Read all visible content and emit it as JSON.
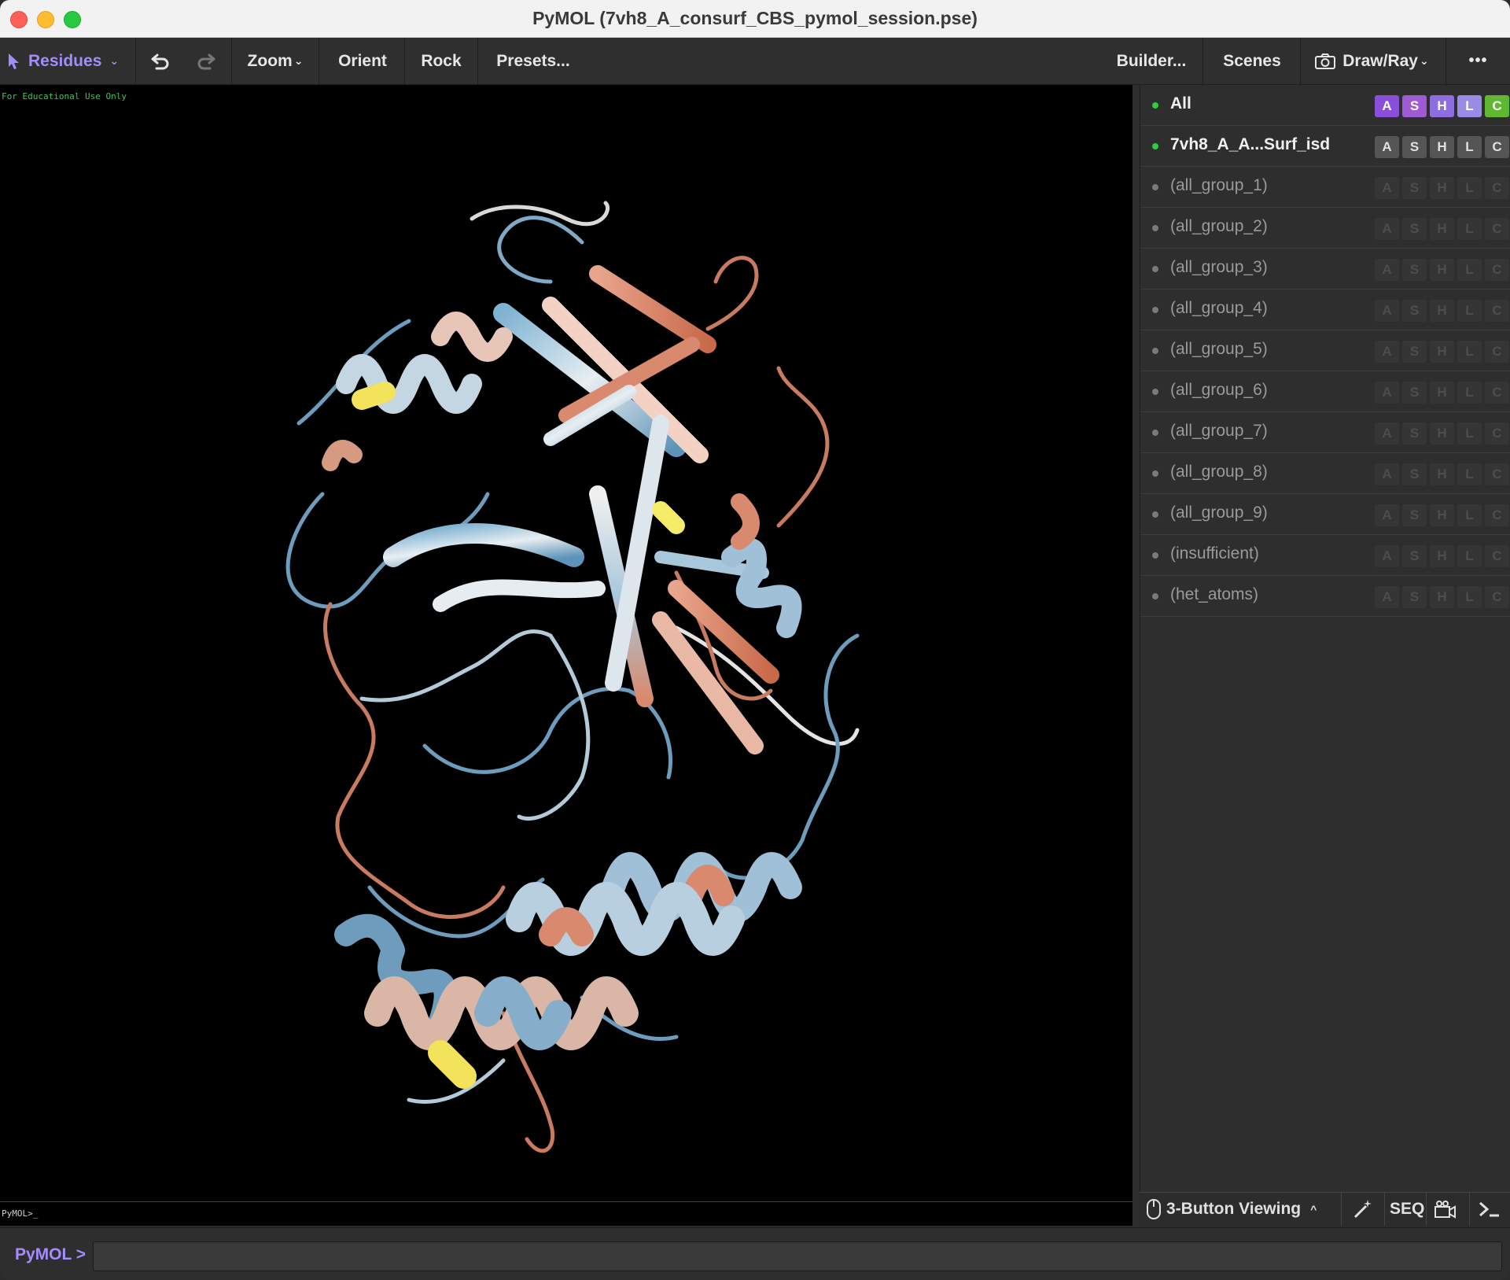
{
  "window": {
    "title": "PyMOL (7vh8_A_consurf_CBS_pymol_session.pse)"
  },
  "toolbar": {
    "residues_label": "Residues",
    "zoom_label": "Zoom",
    "orient_label": "Orient",
    "rock_label": "Rock",
    "presets_label": "Presets...",
    "builder_label": "Builder...",
    "scenes_label": "Scenes",
    "drawray_label": "Draw/Ray",
    "more_label": "•••"
  },
  "viewport": {
    "watermark": "For Educational Use Only",
    "prompt_text": "PyMOL>_"
  },
  "objects": [
    {
      "label": "All",
      "enabled": true,
      "bold": true
    },
    {
      "label": "7vh8_A_A...Surf_isd",
      "enabled": true,
      "bold": true
    },
    {
      "label": "(all_group_1)",
      "enabled": false
    },
    {
      "label": "(all_group_2)",
      "enabled": false
    },
    {
      "label": "(all_group_3)",
      "enabled": false
    },
    {
      "label": "(all_group_4)",
      "enabled": false
    },
    {
      "label": "(all_group_5)",
      "enabled": false
    },
    {
      "label": "(all_group_6)",
      "enabled": false
    },
    {
      "label": "(all_group_7)",
      "enabled": false
    },
    {
      "label": "(all_group_8)",
      "enabled": false
    },
    {
      "label": "(all_group_9)",
      "enabled": false
    },
    {
      "label": "(insufficient)",
      "enabled": false
    },
    {
      "label": "(het_atoms)",
      "enabled": false
    }
  ],
  "action_buttons": [
    "A",
    "S",
    "H",
    "L",
    "C"
  ],
  "colors": {
    "accent": "#a48cff",
    "all_A": "#8a4fd8",
    "all_S": "#a05ad6",
    "all_H": "#8c6ee0",
    "all_L": "#9a8ce6",
    "all_C": "#5fb82f",
    "enabled_dot": "#2ecc40",
    "disabled_dot": "#7a7a7a"
  },
  "statusbar": {
    "mouse_mode": "3-Button Viewing",
    "seq_label": "SEQ"
  },
  "command": {
    "label": "PyMOL >",
    "value": ""
  }
}
